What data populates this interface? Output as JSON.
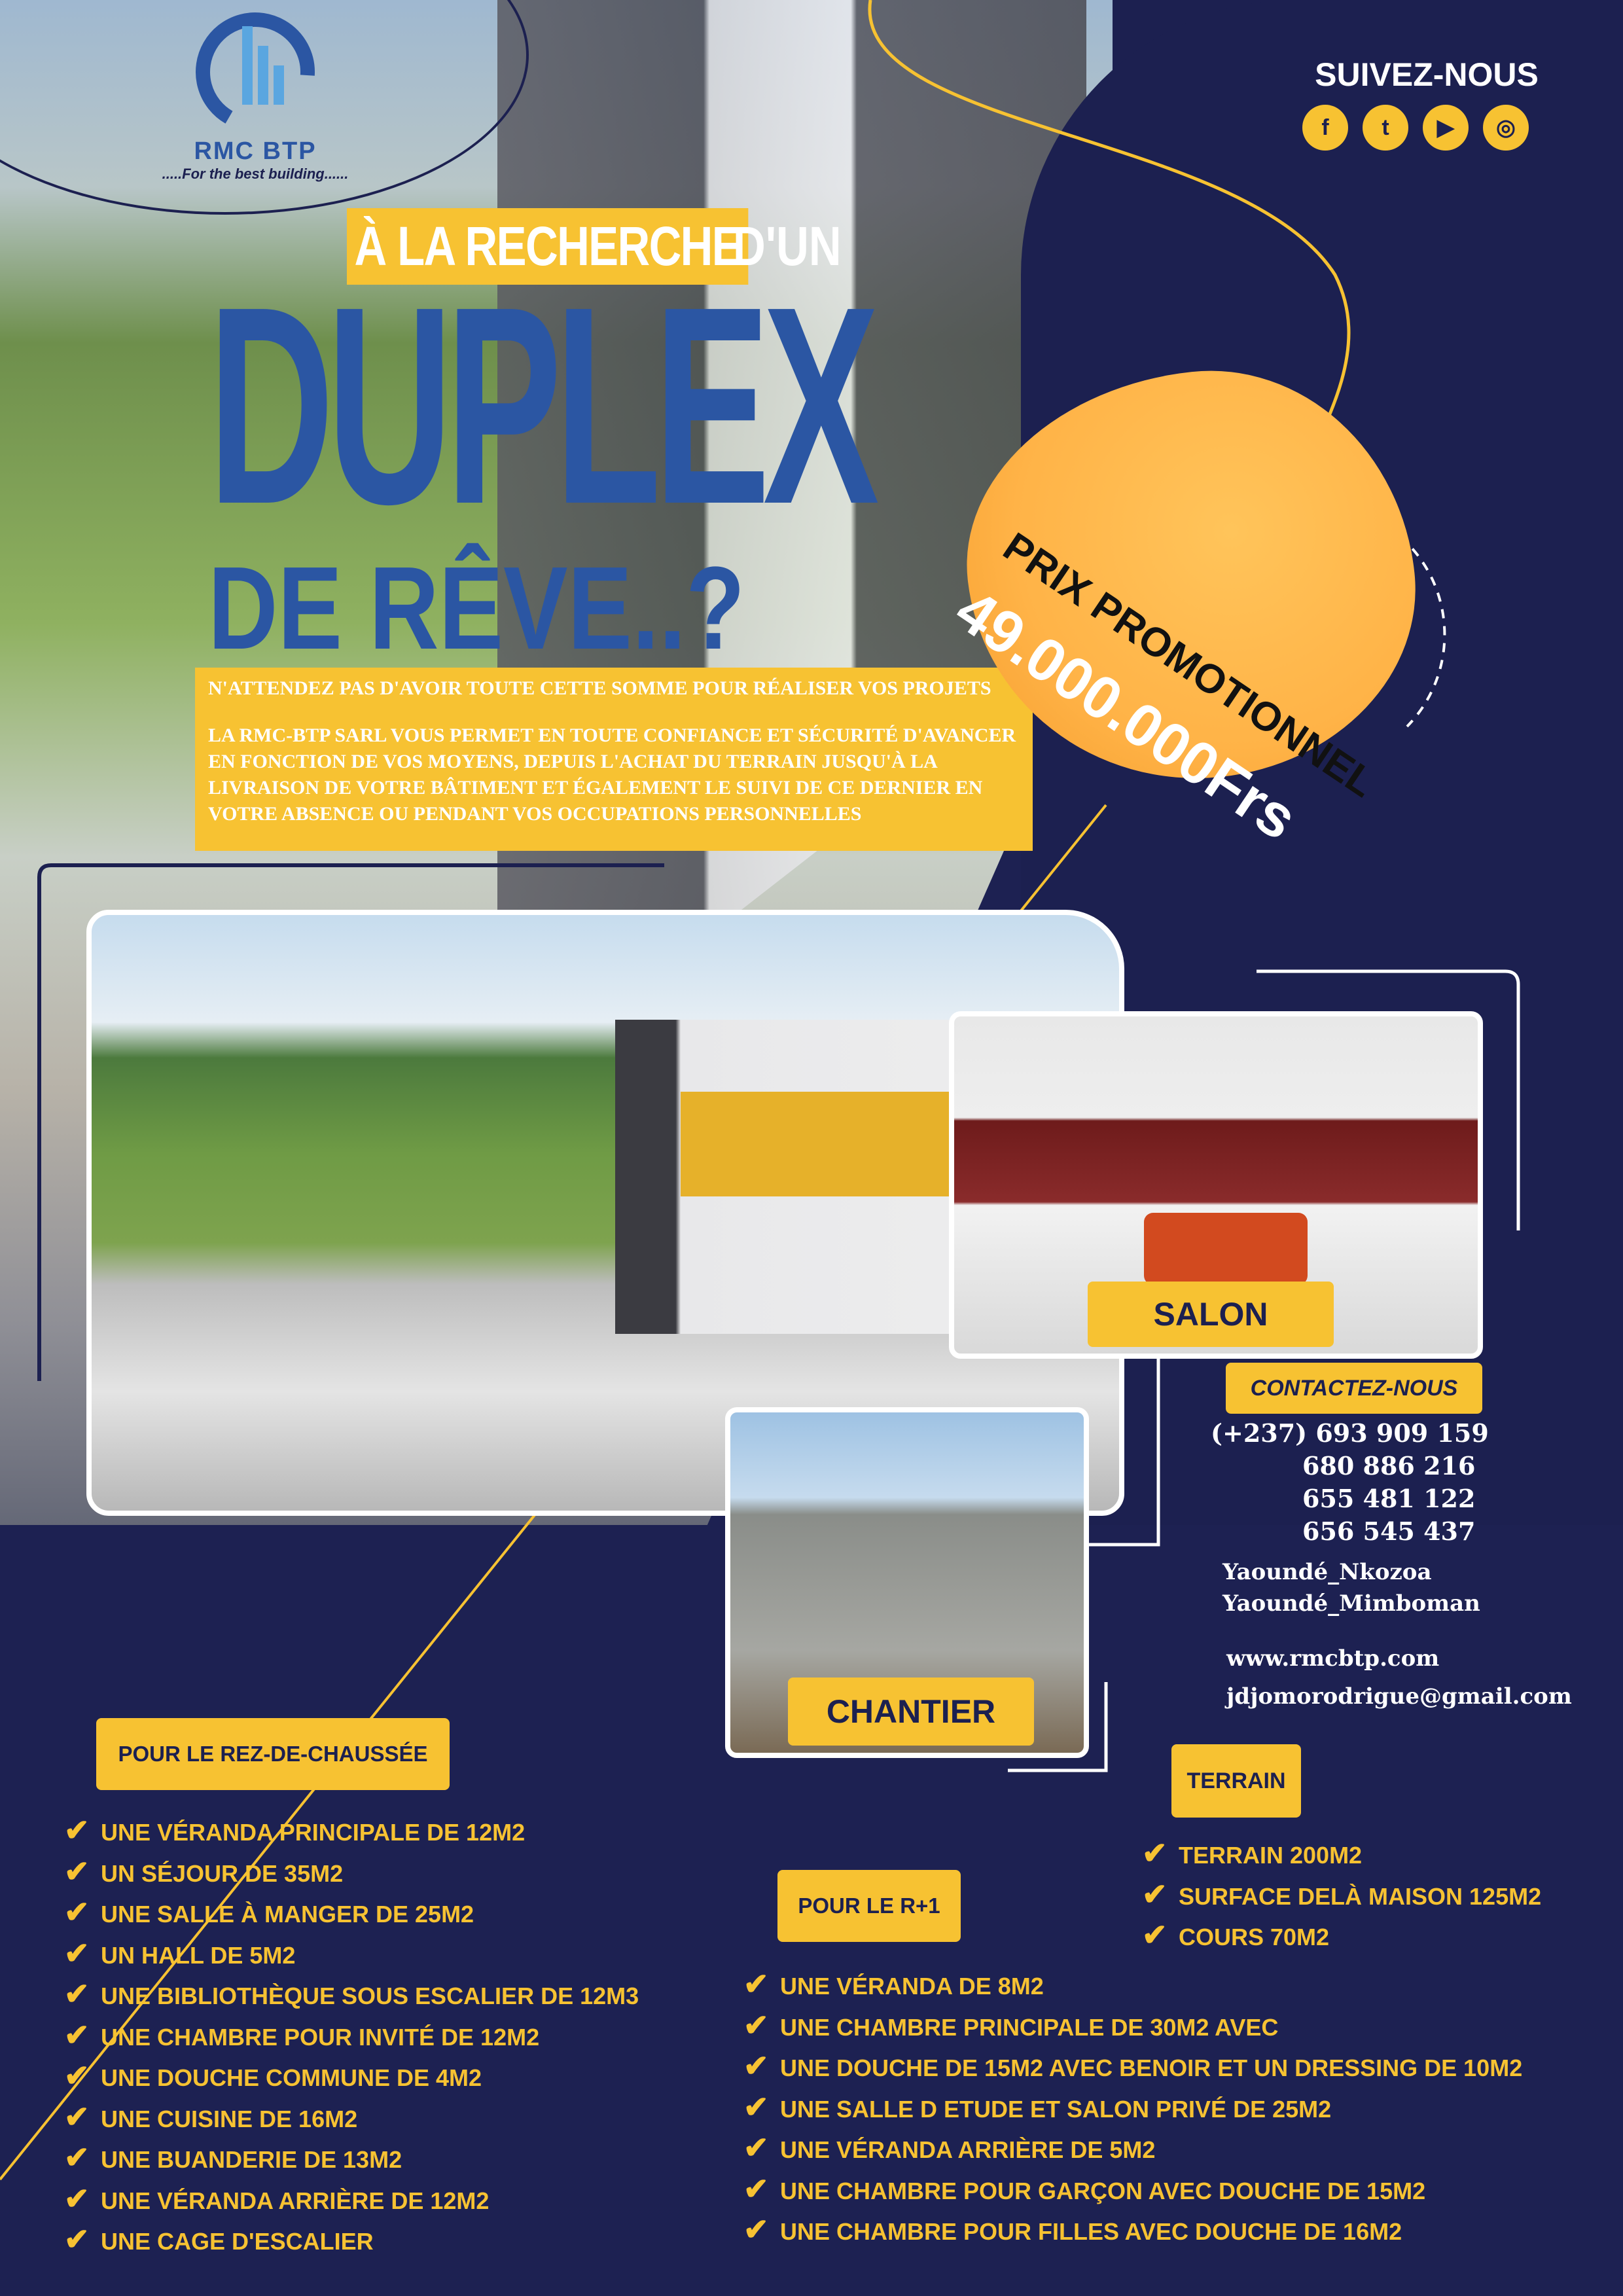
{
  "brand": {
    "name": "RMC BTP",
    "tagline": ".....For the best building......"
  },
  "social": {
    "title": "SUIVEZ-NOUS",
    "icons": [
      "facebook-icon",
      "twitter-icon",
      "youtube-icon",
      "instagram-icon"
    ],
    "glyphs": [
      "f",
      "t",
      "▶",
      "◎"
    ]
  },
  "headline": {
    "highlight": "À LA RECHERCHE",
    "rest": "D'UN",
    "main": "DUPLEX",
    "sub": "DE RÊVE..?"
  },
  "intro": {
    "line1": "N'ATTENDEZ PAS D'AVOIR TOUTE CETTE SOMME POUR RÉALISER VOS PROJETS",
    "line2": "LA RMC-BTP SARL VOUS PERMET EN TOUTE CONFIANCE ET SÉCURITÉ D'AVANCER EN FONCTION DE VOS MOYENS, DEPUIS L'ACHAT DU TERRAIN JUSQU'À LA LIVRAISON DE VOTRE BÂTIMENT ET ÉGALEMENT LE SUIVI DE CE DERNIER EN VOTRE ABSENCE OU PENDANT VOS OCCUPATIONS PERSONNELLES"
  },
  "promo": {
    "label": "PRIX PROMOTIONNEL",
    "price": "49.000.000Frs"
  },
  "photos": {
    "salon_label": "SALON",
    "chantier_label": "CHANTIER"
  },
  "contact": {
    "title": "CONTACTEZ-NOUS",
    "phones": [
      "(+237) 693 909 159",
      "680 886 216",
      "655 481 122",
      "656 545 437"
    ],
    "locations": [
      "Yaoundé_Nkozoa",
      "Yaoundé_Mimboman"
    ],
    "website": "www.rmcbtp.com",
    "email": "jdjomorodrigue@gmail.com"
  },
  "rdc": {
    "title": "POUR LE REZ-DE-CHAUSSÉE",
    "items": [
      "UNE VÉRANDA PRINCIPALE DE 12M2",
      "UN SÉJOUR DE 35M2",
      "UNE SALLE À MANGER DE 25M2",
      "UN HALL DE 5M2",
      "UNE BIBLIOTHÈQUE SOUS ESCALIER DE 12M3",
      "UNE CHAMBRE POUR INVITÉ DE 12M2",
      "UNE DOUCHE COMMUNE DE 4M2",
      "UNE CUISINE DE 16M2",
      "UNE BUANDERIE DE 13M2",
      "UNE VÉRANDA ARRIÈRE DE 12M2",
      "UNE CAGE D'ESCALIER"
    ]
  },
  "r1": {
    "title": "POUR LE R+1",
    "items": [
      "UNE VÉRANDA DE 8M2",
      "UNE CHAMBRE PRINCIPALE DE 30M2 AVEC",
      "UNE DOUCHE DE 15M2 AVEC BENOIR ET UN DRESSING DE 10M2",
      "UNE SALLE D ETUDE ET SALON PRIVÉ DE 25M2",
      "UNE VÉRANDA ARRIÈRE DE 5M2",
      "UNE CHAMBRE POUR GARÇON AVEC DOUCHE DE 15M2",
      "UNE CHAMBRE POUR FILLES AVEC DOUCHE DE 16M2"
    ]
  },
  "terrain": {
    "title": "TERRAIN",
    "items": [
      "TERRAIN 200M2",
      "SURFACE DELÀ MAISON 125M2",
      "COURS 70M2"
    ]
  },
  "check_glyph": "✔",
  "colors": {
    "navy": "#1c2050",
    "accent": "#f7c232",
    "title_blue": "#2b56a3",
    "promo_orange": "#ffb347"
  }
}
